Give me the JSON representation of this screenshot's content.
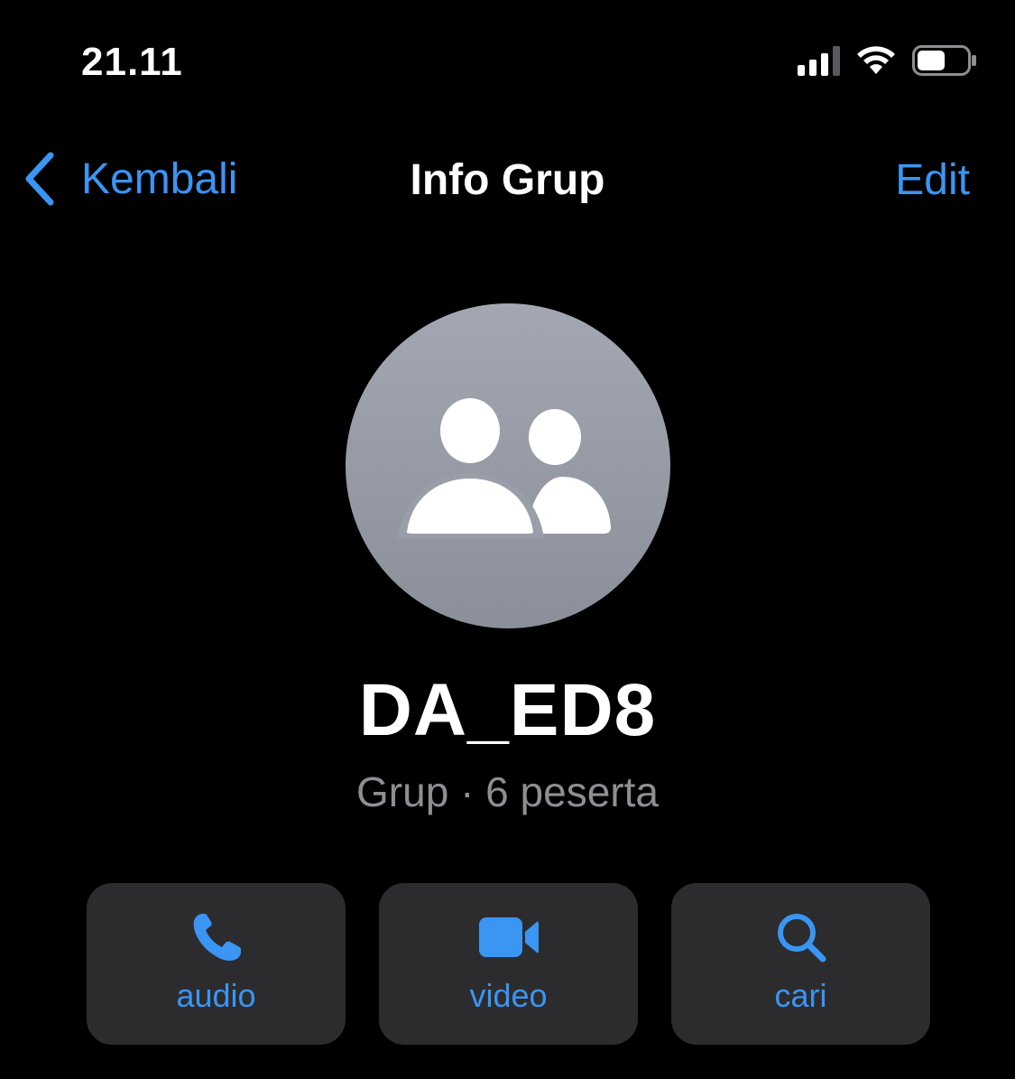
{
  "status_bar": {
    "time": "21.11",
    "icons": [
      "signal-icon",
      "wifi-icon",
      "battery-icon"
    ]
  },
  "nav": {
    "back_label": "Kembali",
    "title": "Info Grup",
    "edit_label": "Edit"
  },
  "group": {
    "avatar_icon": "group-people-icon",
    "name": "DA_ED8",
    "subtitle": "Grup · 6 peserta"
  },
  "actions": [
    {
      "icon": "phone-icon",
      "label": "audio"
    },
    {
      "icon": "video-camera-icon",
      "label": "video"
    },
    {
      "icon": "search-icon",
      "label": "cari"
    }
  ],
  "colors": {
    "background": "#000000",
    "accent": "#3a95f3",
    "secondary_text": "#8e8e93",
    "button_bg": "#2c2c2e"
  }
}
